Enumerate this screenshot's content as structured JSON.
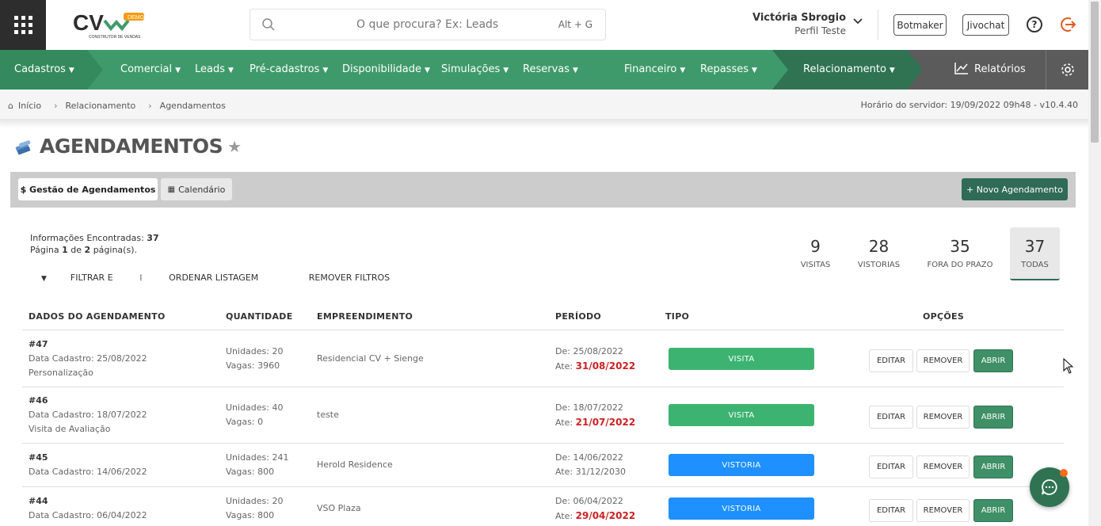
{
  "header": {
    "search_placeholder": "O que procura? Ex: Leads",
    "search_shortcut": "Alt + G",
    "user_name": "Victória Sbrogio",
    "user_profile": "Perfil Teste",
    "btn_botmaker": "Botmaker",
    "btn_jivochat": "Jivochat",
    "logo_demo": "DEMO",
    "logo_sub": "CONSTRUTOR DE VENDAS"
  },
  "nav": {
    "items": [
      "Cadastros",
      "Comercial",
      "Leads",
      "Pré-cadastros",
      "Disponibilidade",
      "Simulações",
      "Reservas",
      "Financeiro",
      "Repasses",
      "Relacionamento"
    ],
    "reports": "Relatórios"
  },
  "breadcrumb": {
    "home": "Início",
    "level1": "Relacionamento",
    "level2": "Agendamentos",
    "server_time": "Horário do servidor: 19/09/2022 09h48 - v10.4.40"
  },
  "page": {
    "title": "AGENDAMENTOS",
    "tab_gestao": "$ Gestão de Agendamentos",
    "tab_calendario": "Calendário",
    "new_button": "+ Novo Agendamento",
    "info_found_label": "Informações Encontradas:",
    "info_found_value": "37",
    "page_prefix": "Página",
    "page_current": "1",
    "page_mid": "de",
    "page_total": "2",
    "page_suffix": "página(s).",
    "filter_label": "FILTRAR E",
    "order_label": "ORDENAR LISTAGEM",
    "remove_filters": "REMOVER FILTROS"
  },
  "stats": [
    {
      "value": "9",
      "label": "VISITAS"
    },
    {
      "value": "28",
      "label": "VISTORIAS"
    },
    {
      "value": "35",
      "label": "FORA DO PRAZO"
    },
    {
      "value": "37",
      "label": "TODAS"
    }
  ],
  "table": {
    "headers": [
      "DADOS DO AGENDAMENTO",
      "QUANTIDADE",
      "EMPREENDIMENTO",
      "PERÍODO",
      "TIPO",
      "OPÇÕES"
    ],
    "btn_edit": "EDITAR",
    "btn_remove": "REMOVER",
    "btn_open": "ABRIR",
    "rows": [
      {
        "id": "#47",
        "cadastro": "Data Cadastro: 25/08/2022",
        "extra": "Personalização",
        "unidades": "Unidades: 20",
        "vagas": "Vagas: 3960",
        "empreendimento": "Residencial CV + Sienge",
        "de": "De: 25/08/2022",
        "ate_label": "Ate:",
        "ate": "31/08/2022",
        "tipo": "VISITA",
        "color": "#3cb371"
      },
      {
        "id": "#46",
        "cadastro": "Data Cadastro: 18/07/2022",
        "extra": "Visita de Avaliação",
        "unidades": "Unidades: 40",
        "vagas": "Vagas: 0",
        "empreendimento": "teste",
        "de": "De: 18/07/2022",
        "ate_label": "Ate:",
        "ate": "21/07/2022",
        "tipo": "VISITA",
        "color": "#3cb371"
      },
      {
        "id": "#45",
        "cadastro": "Data Cadastro: 14/06/2022",
        "extra": "",
        "unidades": "Unidades: 241",
        "vagas": "Vagas: 800",
        "empreendimento": "Herold Residence",
        "de": "De: 14/06/2022",
        "ate_label": "Ate:",
        "ate": "31/12/2030",
        "tipo": "VISTORIA",
        "color": "#1e90ff"
      },
      {
        "id": "#44",
        "cadastro": "Data Cadastro: 06/04/2022",
        "extra": "",
        "unidades": "Unidades: 20",
        "vagas": "Vagas: 800",
        "empreendimento": "VSO Plaza",
        "de": "De: 06/04/2022",
        "ate_label": "Ate:",
        "ate": "29/04/2022",
        "tipo": "VISTORIA",
        "color": "#1e90ff"
      }
    ]
  }
}
